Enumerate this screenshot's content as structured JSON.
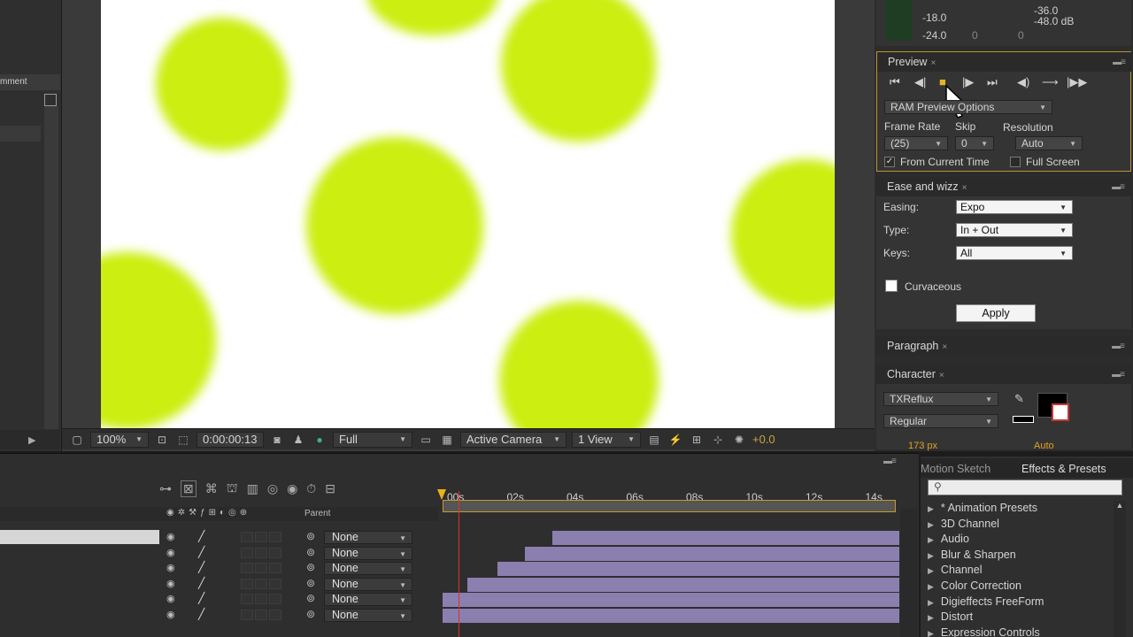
{
  "left_panel": {
    "header_label": "mment"
  },
  "viewer": {
    "zoom": "100%",
    "timecode": "0:00:00:13",
    "resolution": "Full",
    "camera": "Active Camera",
    "views": "1 View",
    "exposure": "+0.0",
    "canvas_color": "#ccee10"
  },
  "audio": {
    "db_1": "-18.0",
    "db_2": "-24.0",
    "db_3": "-36.0",
    "db_4": "-48.0 dB",
    "zero_1": "0",
    "zero_2": "0"
  },
  "preview": {
    "tab": "Preview",
    "ram_options": "RAM Preview Options",
    "frame_rate_label": "Frame Rate",
    "skip_label": "Skip",
    "resolution_label": "Resolution",
    "frame_rate_value": "(25)",
    "skip_value": "0",
    "resolution_value": "Auto",
    "from_current": "From Current Time",
    "full_screen": "Full Screen"
  },
  "ease": {
    "tab": "Ease and wizz",
    "easing_label": "Easing:",
    "easing_value": "Expo",
    "type_label": "Type:",
    "type_value": "In + Out",
    "keys_label": "Keys:",
    "keys_value": "All",
    "curvaceous": "Curvaceous",
    "apply": "Apply"
  },
  "paragraph": {
    "tab": "Paragraph"
  },
  "character": {
    "tab": "Character",
    "font": "TXReflux",
    "style": "Regular",
    "size": "173 px",
    "leading": "Auto"
  },
  "timeline": {
    "parent_header": "Parent",
    "ticks": [
      "00s",
      "02s",
      "04s",
      "06s",
      "08s",
      "10s",
      "12s",
      "14s"
    ],
    "layers": [
      {
        "parent": "None",
        "start": 0.24
      },
      {
        "parent": "None",
        "start": 0.18
      },
      {
        "parent": "None",
        "start": 0.12
      },
      {
        "parent": "None",
        "start": 0.055
      },
      {
        "parent": "None",
        "start": 0.0
      },
      {
        "parent": "None",
        "start": 0.0
      }
    ]
  },
  "effects": {
    "tab_motion": "Motion Sketch",
    "tab_effects": "Effects & Presets",
    "items": [
      "* Animation Presets",
      "3D Channel",
      "Audio",
      "Blur & Sharpen",
      "Channel",
      "Color Correction",
      "Digieffects FreeForm",
      "Distort",
      "Expression Controls"
    ]
  }
}
